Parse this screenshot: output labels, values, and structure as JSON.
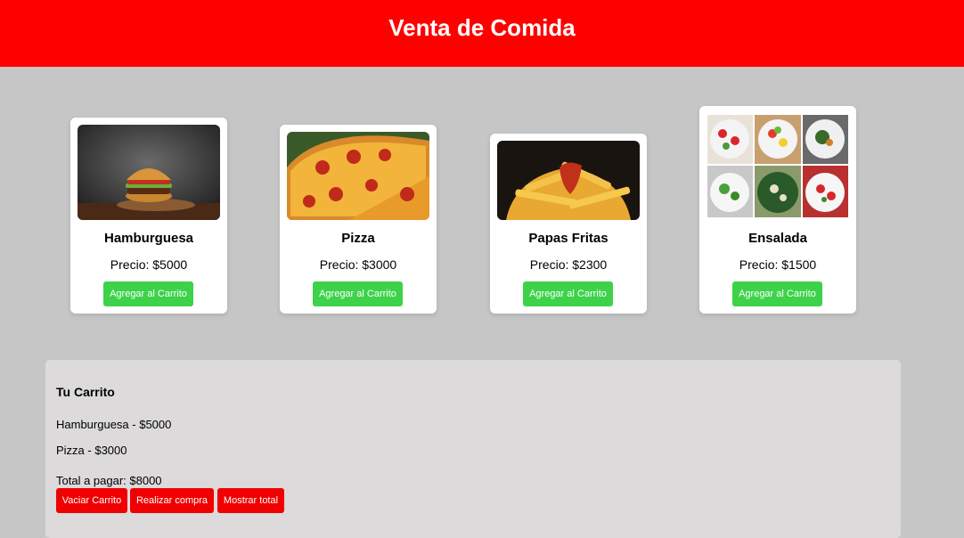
{
  "header": {
    "title": "Venta de Comida"
  },
  "products": [
    {
      "name": "Hamburguesa",
      "price": "Precio: $5000",
      "button": "Agregar al Carrito"
    },
    {
      "name": "Pizza",
      "price": "Precio: $3000",
      "button": "Agregar al Carrito"
    },
    {
      "name": "Papas Fritas",
      "price": "Precio: $2300",
      "button": "Agregar al Carrito"
    },
    {
      "name": "Ensalada",
      "price": "Precio: $1500",
      "button": "Agregar al Carrito"
    }
  ],
  "cart": {
    "title": "Tu Carrito",
    "items": [
      "Hamburguesa - $5000",
      "Pizza - $3000"
    ],
    "total": "Total a pagar: $8000",
    "buttons": {
      "clear": "Vaciar Carrito",
      "buy": "Realizar compra",
      "show_total": "Mostrar total"
    }
  },
  "colors": {
    "header": "#ff0000",
    "add_button": "#3dd24a",
    "cart_button": "#f00000"
  }
}
